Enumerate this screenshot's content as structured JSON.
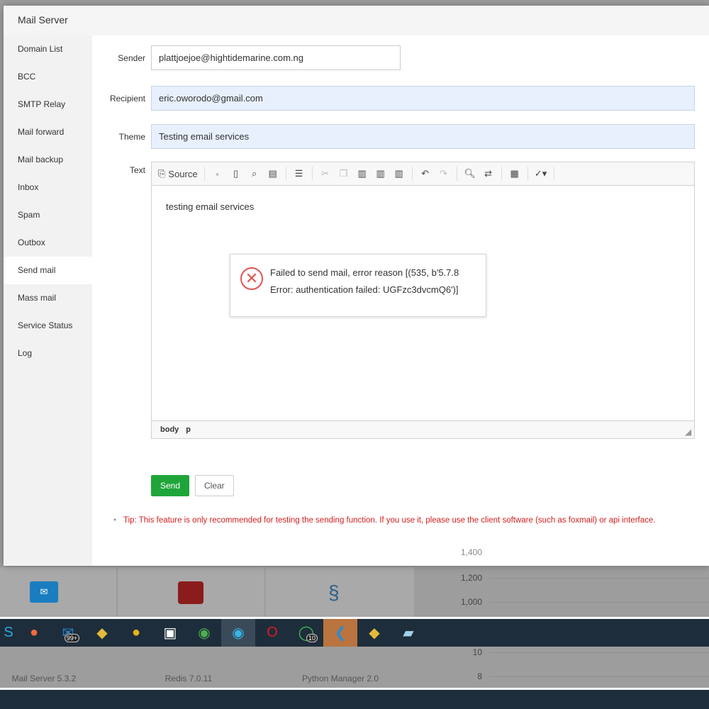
{
  "modal": {
    "title": "Mail Server"
  },
  "sidebar": {
    "items": [
      {
        "label": "Domain List"
      },
      {
        "label": "BCC"
      },
      {
        "label": "SMTP Relay"
      },
      {
        "label": "Mail forward"
      },
      {
        "label": "Mail backup"
      },
      {
        "label": "Inbox"
      },
      {
        "label": "Spam"
      },
      {
        "label": "Outbox"
      },
      {
        "label": "Send mail"
      },
      {
        "label": "Mass mail"
      },
      {
        "label": "Service Status"
      },
      {
        "label": "Log"
      }
    ],
    "active": "Send mail"
  },
  "form": {
    "sender_label": "Sender",
    "sender": "plattjoejoe@hightidemarine.com.ng",
    "recipient_label": "Recipient",
    "recipient": "eric.oworodo@gmail.com",
    "theme_label": "Theme",
    "theme": "Testing email services",
    "text_label": "Text"
  },
  "editor": {
    "source_label": "Source",
    "content": "testing email services",
    "path": [
      "body",
      "p"
    ]
  },
  "error": {
    "line1": "Failed to send mail, error reason [(535, b'5.7.8",
    "line2": "Error: authentication failed: UGFzc3dvcmQ6')]"
  },
  "buttons": {
    "send": "Send",
    "clear": "Clear"
  },
  "tip": "Tip: This feature is only recommended for testing the sending function. If you use it, please use the client software (such as foxmail) or api interface.",
  "background": {
    "apps": [
      {
        "label": "Mail Server 5.3.2"
      },
      {
        "label": "Redis 7.0.11"
      },
      {
        "label": "Python Manager 2.0"
      }
    ],
    "ticks_top": [
      "1,400",
      "1,200",
      "1,000"
    ],
    "ticks_bottom": [
      "10",
      "8"
    ]
  },
  "taskbar": {
    "mail_badge": "99+",
    "whatsapp_badge": "10"
  },
  "colors": {
    "accent": "#20a53a",
    "error": "#e25353",
    "tip": "#d12020",
    "taskbar": "#1e2d3b"
  }
}
